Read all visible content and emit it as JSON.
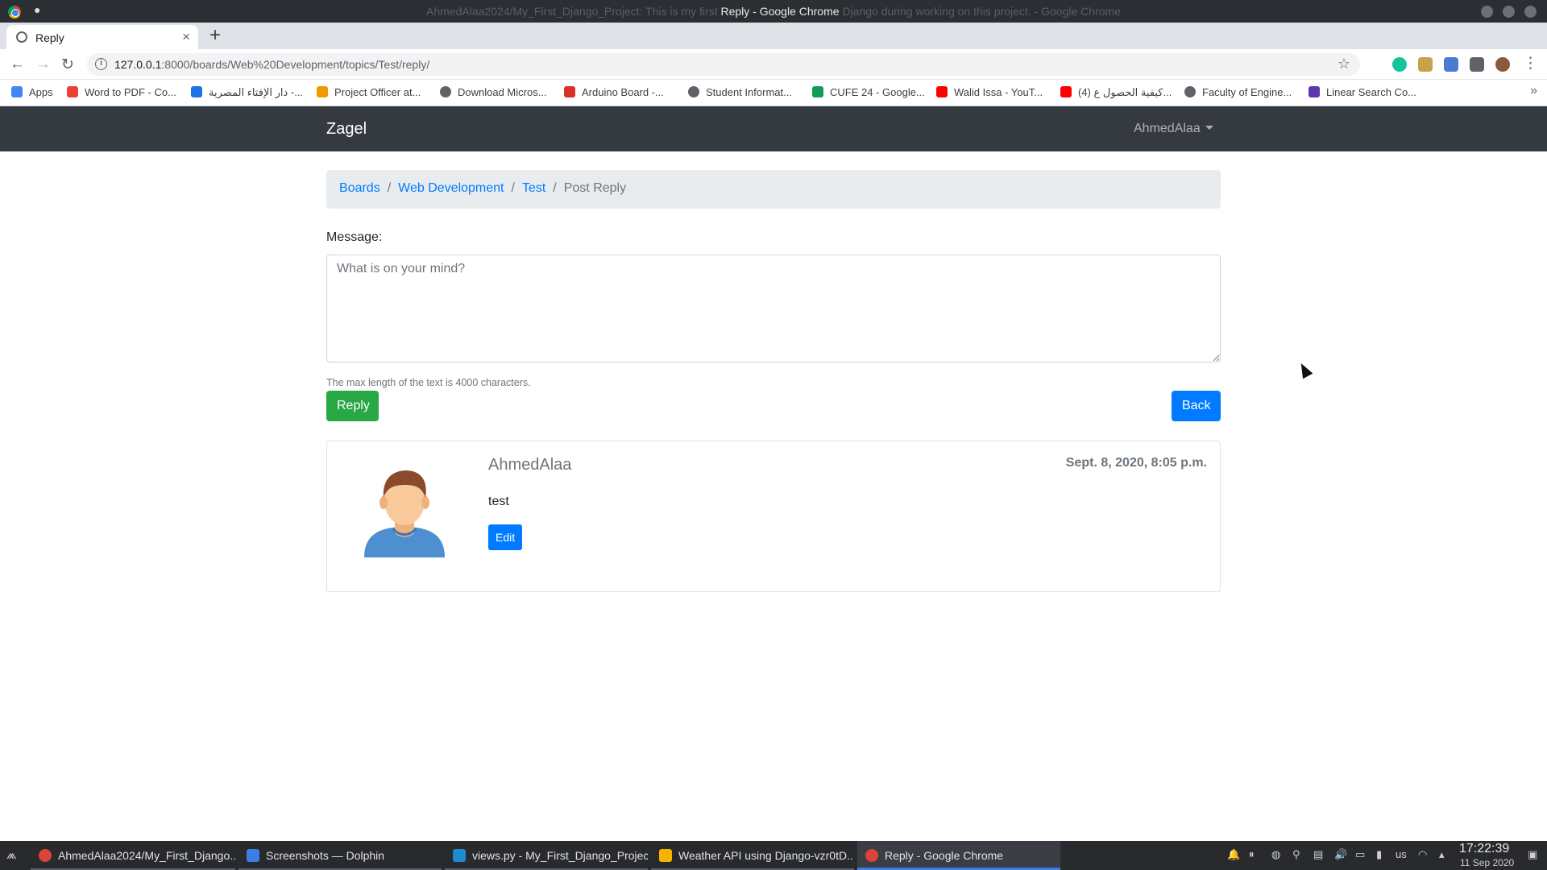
{
  "window": {
    "title_prefix": "AhmedAlaa2024/My_First_Django_Project: This is my first",
    "title_main": "Reply - Google Chrome",
    "title_suffix": "Django during working on this project. - Google Chrome"
  },
  "tabs": [
    {
      "label": "Reply",
      "close": "×"
    }
  ],
  "toolbar": {
    "back": "←",
    "forward": "→",
    "reload": "↻",
    "url_host": "127.0.0.1",
    "url_path": ":8000/boards/Web%20Development/topics/Test/reply/",
    "star": "☆",
    "newtab": "+"
  },
  "bookmarks": [
    {
      "label": "Apps",
      "color": "#4285f4"
    },
    {
      "label": "Word to PDF - Co...",
      "color": "#e94235"
    },
    {
      "label": "دار الإفتاء المصرية -...",
      "color": "#1a73e8"
    },
    {
      "label": "Project Officer at...",
      "color": "#f29900"
    },
    {
      "label": "Download Micros...",
      "color": "#5f6368"
    },
    {
      "label": "Arduino Board -...",
      "color": "#d93025"
    },
    {
      "label": "Student Informat...",
      "color": "#5f6368"
    },
    {
      "label": "CUFE 24 - Google...",
      "color": "#0f9d58"
    },
    {
      "label": "Walid Issa - YouT...",
      "color": "#ff0000"
    },
    {
      "label": "(4) كيفية الحصول ع...",
      "color": "#ff0000"
    },
    {
      "label": "Faculty of Engine...",
      "color": "#5f6368"
    },
    {
      "label": "Linear Search Co...",
      "color": "#5e35b1"
    }
  ],
  "bookmarks_more": "»",
  "site": {
    "brand": "Zagel",
    "user": "AhmedAlaa"
  },
  "breadcrumb": {
    "boards": "Boards",
    "board": "Web Development",
    "topic": "Test",
    "current": "Post Reply",
    "separator": "/"
  },
  "form": {
    "message_label": "Message:",
    "placeholder": "What is on your mind?",
    "help_text": "The max length of the text is 4000 characters.",
    "reply_button": "Reply",
    "back_button": "Back"
  },
  "post": {
    "author": "AhmedAlaa",
    "date": "Sept. 8, 2020, 8:05 p.m.",
    "message": "test",
    "edit_button": "Edit"
  },
  "taskbar": {
    "tasks": [
      {
        "label": "AhmedAlaa2024/My_First_Django...",
        "color": "#db4437"
      },
      {
        "label": "Screenshots — Dolphin",
        "color": "#3d7ee6"
      },
      {
        "label": "views.py - My_First_Django_Projec...",
        "color": "#1f8ad2"
      },
      {
        "label": "Weather API using Django-vzr0tD...",
        "color": "#f4b400"
      },
      {
        "label": "Reply - Google Chrome",
        "color": "#db4437"
      }
    ],
    "keyboard_layout": "us",
    "time": "17:22:39",
    "date": "11 Sep 2020"
  }
}
